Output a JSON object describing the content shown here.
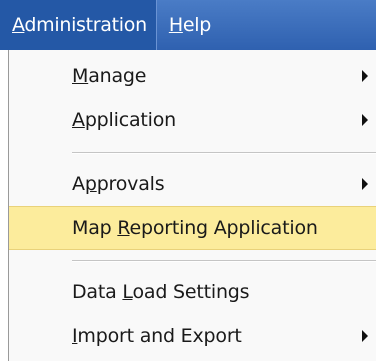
{
  "menubar": {
    "items": [
      {
        "label": "Administration",
        "mnemonic_index": 0,
        "active": true
      },
      {
        "label": "Help",
        "mnemonic_index": 0,
        "active": false
      }
    ]
  },
  "menu": {
    "items": [
      {
        "label": "Manage",
        "mnemonic_index": 0,
        "has_submenu": true
      },
      {
        "label": "Application",
        "mnemonic_index": 0,
        "has_submenu": true
      },
      {
        "label": "Approvals",
        "mnemonic_index": 1,
        "has_submenu": true
      },
      {
        "label": "Map Reporting Application",
        "mnemonic_index": 4,
        "has_submenu": false,
        "highlighted": true
      },
      {
        "label": "Data Load Settings",
        "mnemonic_index": 5,
        "has_submenu": false
      },
      {
        "label": "Import and Export",
        "mnemonic_index": 0,
        "has_submenu": true
      }
    ]
  },
  "colors": {
    "menubar_bg": "#3b6db9",
    "highlight_bg": "#fcec9c",
    "menu_bg": "#f9f9f9"
  }
}
